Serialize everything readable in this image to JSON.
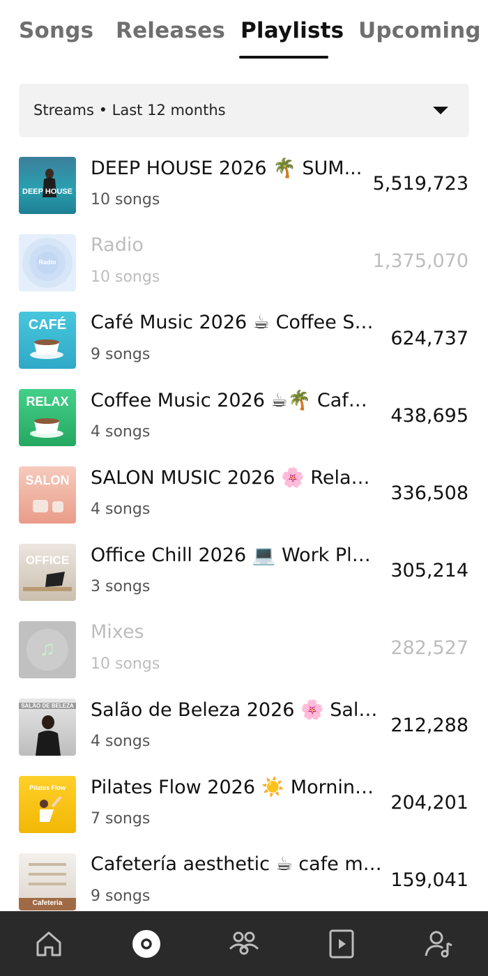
{
  "tabs": [
    {
      "label": "Songs",
      "active": false
    },
    {
      "label": "Releases",
      "active": false
    },
    {
      "label": "Playlists",
      "active": true
    },
    {
      "label": "Upcoming",
      "active": false
    }
  ],
  "filter": {
    "label": "Streams • Last 12 months"
  },
  "playlists": [
    {
      "title": "DEEP HOUSE 2026 🌴 SUM...",
      "songs": "10 songs",
      "streams": "5,519,723",
      "dim": false,
      "art_text": "DEEP HOUSE",
      "art_color": "#2a9fb0"
    },
    {
      "title": "Radio",
      "songs": "10 songs",
      "streams": "1,375,070",
      "dim": true,
      "art_text": "Radio",
      "art_color": "#9cc4ef"
    },
    {
      "title": "Café Music 2026 ☕ Coffee Sh...",
      "songs": "9 songs",
      "streams": "624,737",
      "dim": false,
      "art_text": "CAFÉ",
      "art_color": "#3fbcd6"
    },
    {
      "title": "Coffee Music 2026 ☕🌴 Café...",
      "songs": "4 songs",
      "streams": "438,695",
      "dim": false,
      "art_text": "RELAX",
      "art_color": "#3cc47a"
    },
    {
      "title": "SALON MUSIC 2026 🌸 Relax...",
      "songs": "4 songs",
      "streams": "336,508",
      "dim": false,
      "art_text": "SALON",
      "art_color": "#f2b8a8"
    },
    {
      "title": "Office Chill 2026 💻 Work Play...",
      "songs": "3 songs",
      "streams": "305,214",
      "dim": false,
      "art_text": "OFFICE",
      "art_color": "#d9d2c6"
    },
    {
      "title": "Mixes",
      "songs": "10 songs",
      "streams": "282,527",
      "dim": true,
      "art_text": "♫",
      "art_color": "#8e8e8e"
    },
    {
      "title": " Salão de Beleza 2026 🌸 Salo...",
      "songs": "4 songs",
      "streams": "212,288",
      "dim": false,
      "art_text": "SALÃO DE BELEZA",
      "art_color": "#d8d8d8"
    },
    {
      "title": "Pilates Flow 2026 ☀️ Morning ...",
      "songs": "7 songs",
      "streams": "204,201",
      "dim": false,
      "art_text": "Pilates Flow",
      "art_color": "#f5c518"
    },
    {
      "title": "Cafetería aesthetic ☕ cafe mú...",
      "songs": "9 songs",
      "streams": "159,041",
      "dim": false,
      "art_text": "Cafeteria",
      "art_color": "#e8e3dc"
    }
  ],
  "nav": [
    {
      "icon": "home-icon",
      "active": false
    },
    {
      "icon": "music-disc-icon",
      "active": true
    },
    {
      "icon": "audience-icon",
      "active": false
    },
    {
      "icon": "video-icon",
      "active": false
    },
    {
      "icon": "artist-profile-icon",
      "active": false
    }
  ]
}
